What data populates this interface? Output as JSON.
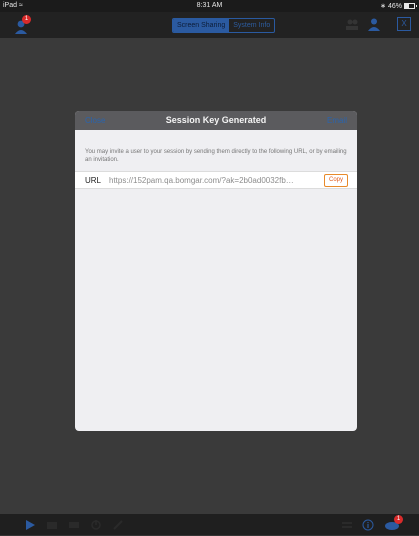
{
  "status_bar": {
    "carrier": "iPad",
    "time": "8:31 AM",
    "battery": "46%",
    "battery_level": 0.46
  },
  "toolbar": {
    "alert_badge_count": "1",
    "tabs": [
      {
        "label": "Screen Sharing",
        "active": true
      },
      {
        "label": "System Info",
        "active": false
      }
    ],
    "close_label": "X",
    "accent_color": "#2b5aa0"
  },
  "modal": {
    "close_label": "Close",
    "title": "Session Key Generated",
    "email_label": "Email",
    "description": "You may invite a user to your session by sending them directly to the following URL, or by emailing an invitation.",
    "url_label": "URL",
    "url_value": "https://152pam.qa.bomgar.com/?ak=2b0ad0032fb…",
    "copy_label": "Copy"
  },
  "bottom_bar": {
    "chat_badge_count": "1",
    "icons": [
      "play-icon",
      "camera-icon",
      "keyboard-icon",
      "power-icon",
      "tools-icon",
      "list-icon",
      "info-icon",
      "chat-icon"
    ]
  }
}
